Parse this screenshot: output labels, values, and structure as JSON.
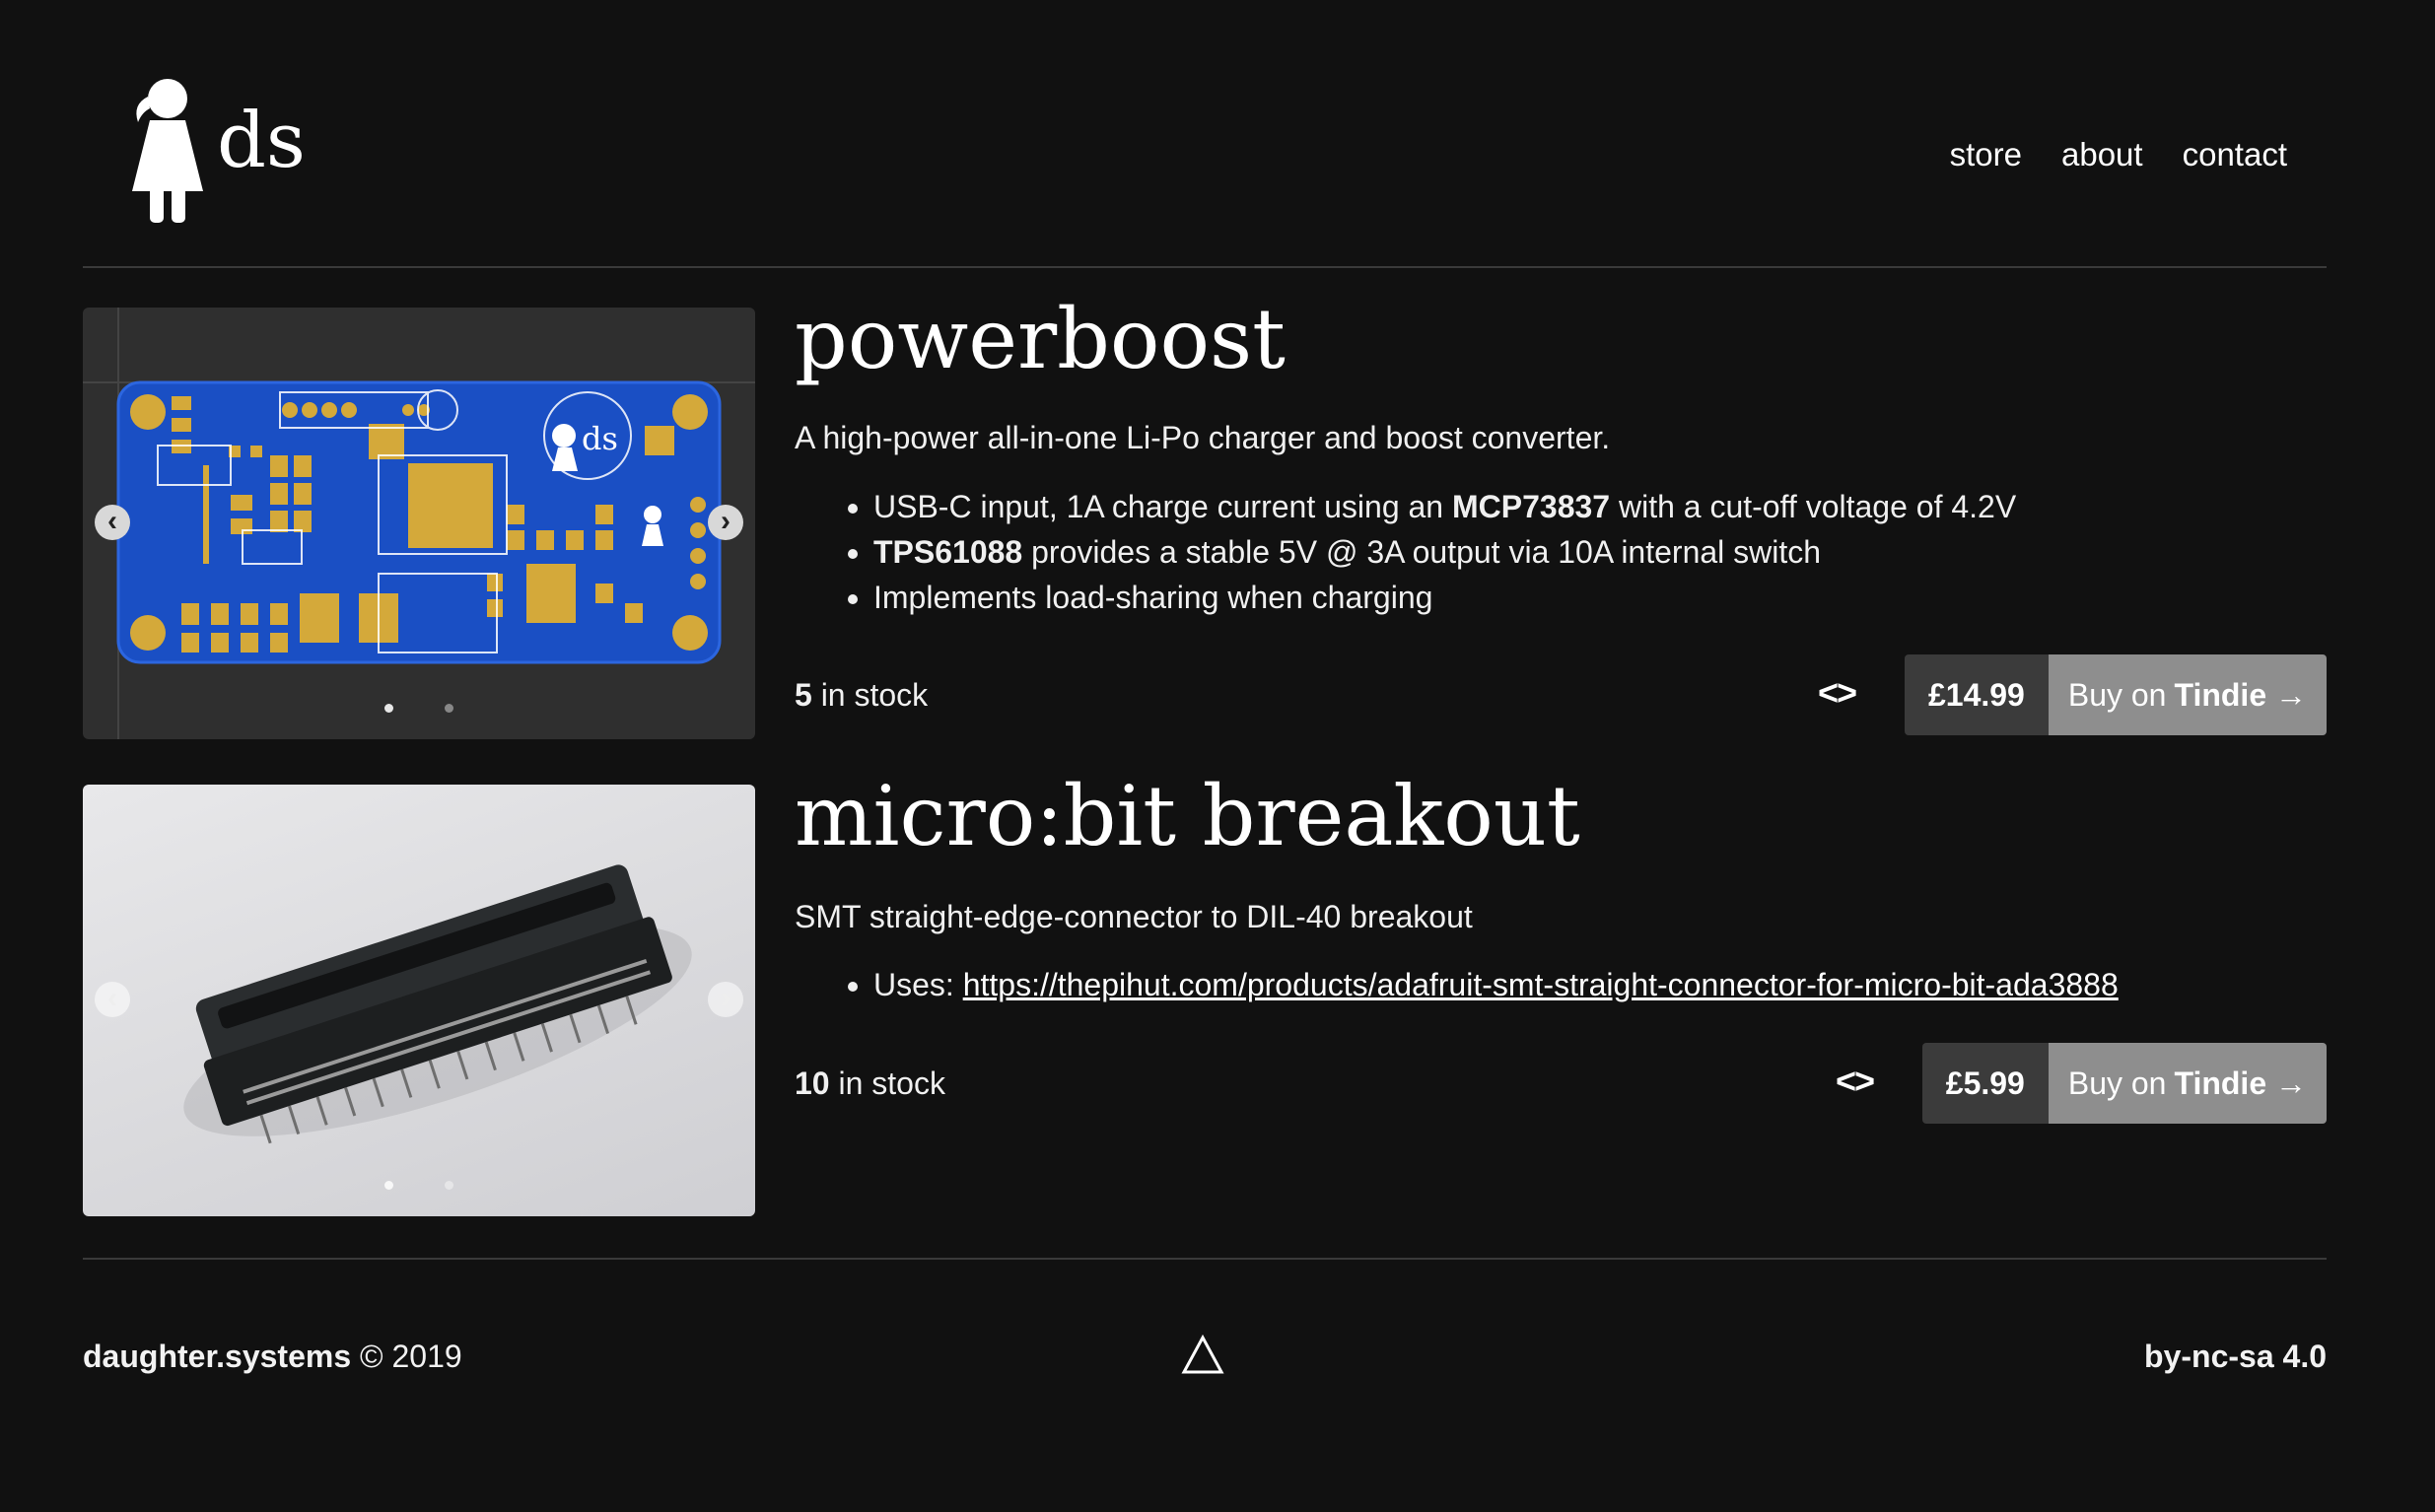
{
  "header": {
    "logo_text": "ds",
    "nav": [
      "store",
      "about",
      "contact"
    ]
  },
  "products": [
    {
      "title": "powerboost",
      "description": "A high-power all-in-one Li-Po charger and boost converter.",
      "features": [
        [
          "USB-C input, 1A charge current using an ",
          "MCP73837",
          " with a cut-off voltage of 4.2V"
        ],
        [
          "TPS61088",
          " provides a stable 5V @ 3A output via 10A internal switch"
        ],
        [
          "Implements load-sharing when charging"
        ]
      ],
      "stock_count": "5",
      "stock_label": "in stock",
      "price": "£14.99",
      "buy_label": "Buy on",
      "buy_brand": "Tindie →"
    },
    {
      "title": "micro:bit breakout",
      "description": "SMT straight-edge-connector to DIL-40 breakout",
      "uses_label": "Uses: ",
      "uses_link": "https://thepihut.com/products/adafruit-smt-straight-connector-for-micro-bit-ada3888",
      "stock_count": "10",
      "stock_label": "in stock",
      "price": "£5.99",
      "buy_label": "Buy on",
      "buy_brand": "Tindie →"
    }
  ],
  "footer": {
    "brand": "daughter.systems",
    "copyright": "© 2019",
    "license": "by-nc-sa 4.0"
  },
  "icons": {
    "logo": "girl-silhouette-icon",
    "carousel_prev": "chevron-left-icon",
    "carousel_next": "chevron-right-icon",
    "source": "code-icon",
    "footer_mark": "triangle-icon"
  },
  "colors": {
    "background": "#111111",
    "pcb_blue": "#1a4fc4",
    "pcb_gold": "#d4a93a",
    "price_bg": "#3b3b3b",
    "buy_bg": "#8e8e8e"
  }
}
